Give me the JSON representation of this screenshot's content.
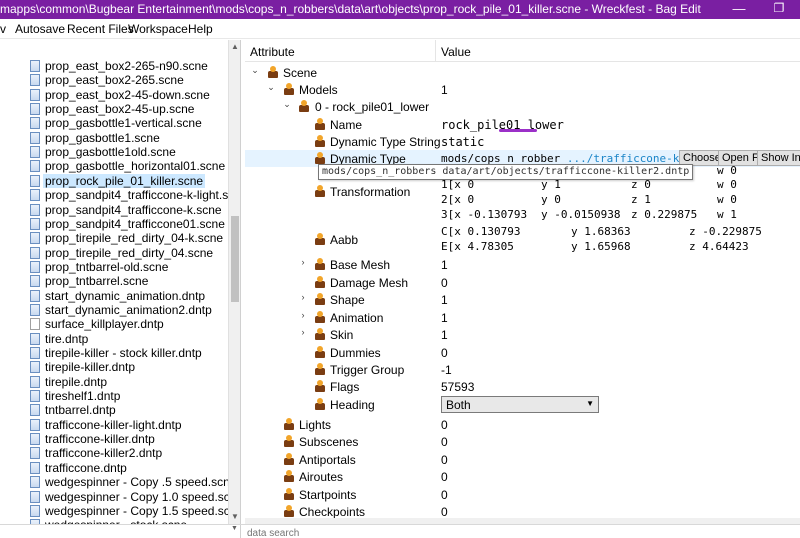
{
  "window": {
    "title": "mapps\\common\\Bugbear Entertainment\\mods\\cops_n_robbers\\data\\art\\objects\\prop_rock_pile_01_killer.scne - Wreckfest - Bag Edit",
    "minimize_glyph": "—",
    "restore_glyph": "❐"
  },
  "menu": {
    "items": [
      "v",
      "Autosave",
      "Recent Files",
      "Workspace",
      "Help"
    ]
  },
  "files": {
    "items": [
      "prop_east_box2-265-n90.scne",
      "prop_east_box2-265.scne",
      "prop_east_box2-45-down.scne",
      "prop_east_box2-45-up.scne",
      "prop_gasbottle1-vertical.scne",
      "prop_gasbottle1.scne",
      "prop_gasbottle1old.scne",
      "prop_gasbottle_horizontal01.scne",
      "prop_rock_pile_01_killer.scne",
      "prop_sandpit4_trafficcone-k-light.scne",
      "prop_sandpit4_trafficcone-k.scne",
      "prop_sandpit4_trafficcone01.scne",
      "prop_tirepile_red_dirty_04-k.scne",
      "prop_tirepile_red_dirty_04.scne",
      "prop_tntbarrel-old.scne",
      "prop_tntbarrel.scne",
      "start_dynamic_animation.dntp",
      "start_dynamic_animation2.dntp",
      "surface_killplayer.dntp",
      "tire.dntp",
      "tirepile-killer - stock killer.dntp",
      "tirepile-killer.dntp",
      "tirepile.dntp",
      "tireshelf1.dntp",
      "tntbarrel.dntp",
      "trafficcone-killer-light.dntp",
      "trafficcone-killer.dntp",
      "trafficcone-killer2.dntp",
      "trafficcone.dntp",
      "wedgespinner - Copy .5 speed.scne",
      "wedgespinner - Copy 1.0 speed.scne",
      "wedgespinner - Copy 1.5 speed.scne",
      "wedgespinner - stock.scne"
    ],
    "selected_index": 8
  },
  "tree": {
    "header_attribute": "Attribute",
    "header_value": "Value",
    "scene": "Scene",
    "models": {
      "label": "Models",
      "value": "1"
    },
    "model0": "0 - rock_pile01_lower",
    "name": {
      "label": "Name",
      "value": "rock_pile01_lower"
    },
    "dyn_type_string": {
      "label": "Dynamic Type String",
      "value": "static"
    },
    "dyn_type": {
      "label": "Dynamic Type",
      "path_prefix": "mods/cops_n_robber",
      "path_suffix": " .../trafficcone-ki",
      "btn_choose": "Choose",
      "btn_open": "Open F",
      "btn_show": "Show In E",
      "tooltip": "mods/cops_n_robbers data/art/objects/trafficcone-killer2.dntp"
    },
    "transformation": {
      "label": "Transformation",
      "rows": [
        [
          "",
          "",
          "",
          "w 0"
        ],
        [
          "1[x 0",
          "y 1",
          "z 0",
          "w 0"
        ],
        [
          "2[x 0",
          "y 0",
          "z 1",
          "w 0"
        ],
        [
          "3[x -0.130793",
          "y -0.0150938",
          "z 0.229875",
          "w 1"
        ]
      ]
    },
    "aabb": {
      "label": "Aabb",
      "rows": [
        [
          "C[x 0.130793",
          "y 1.68363",
          "z -0.229875"
        ],
        [
          "E[x 4.78305",
          "y 1.65968",
          "z 4.64423"
        ]
      ]
    },
    "base_mesh": {
      "label": "Base Mesh",
      "value": "1"
    },
    "damage_mesh": {
      "label": "Damage Mesh",
      "value": "0"
    },
    "shape": {
      "label": "Shape",
      "value": "1"
    },
    "animation": {
      "label": "Animation",
      "value": "1"
    },
    "skin": {
      "label": "Skin",
      "value": "1"
    },
    "dummies": {
      "label": "Dummies",
      "value": "0"
    },
    "trigger_group": {
      "label": "Trigger Group",
      "value": "-1"
    },
    "flags": {
      "label": "Flags",
      "value": "57593"
    },
    "heading": {
      "label": "Heading",
      "value": "Both"
    },
    "lights": {
      "label": "Lights",
      "value": "0"
    },
    "subscenes": {
      "label": "Subscenes",
      "value": "0"
    },
    "antiportals": {
      "label": "Antiportals",
      "value": "0"
    },
    "airoutes": {
      "label": "Airoutes",
      "value": "0"
    },
    "startpoints": {
      "label": "Startpoints",
      "value": "0"
    },
    "checkpoints": {
      "label": "Checkpoints",
      "value": "0"
    }
  },
  "status": {
    "search_placeholder": "data search"
  },
  "colors": {
    "titlebar": "#7a1fa2",
    "selection": "#cce8ff",
    "highlight_row": "#e5f3ff",
    "path_blue": "#1b85c8",
    "annotation_mark": "#9b30c8"
  },
  "icons": {
    "file": "document-icon",
    "node": "bag-node-icon",
    "expand": "chevron-icon"
  }
}
